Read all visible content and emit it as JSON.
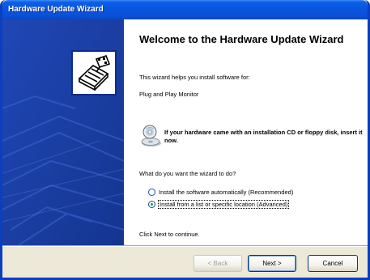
{
  "window": {
    "title": "Hardware Update Wizard"
  },
  "left_panel": {
    "icon": "hardware-wizard-icon",
    "background_color": "#1b41a8"
  },
  "content": {
    "heading": "Welcome to the Hardware Update Wizard",
    "intro": "This wizard helps you install software for:",
    "device_name": "Plug and Play Monitor",
    "cd_notice": "If your hardware came with an installation CD or floppy disk, insert it now.",
    "question": "What do you want the wizard to do?",
    "options": [
      {
        "label": "Install the software automatically (Recommended)",
        "selected": false
      },
      {
        "label": "Install from a list or specific location (Advanced)",
        "selected": true
      }
    ],
    "continue_text": "Click Next to continue."
  },
  "buttons": {
    "back": "< Back",
    "next": "Next >",
    "cancel": "Cancel"
  },
  "colors": {
    "title_bar": "#0a55de",
    "radio_selected": "#1d9a2a"
  }
}
